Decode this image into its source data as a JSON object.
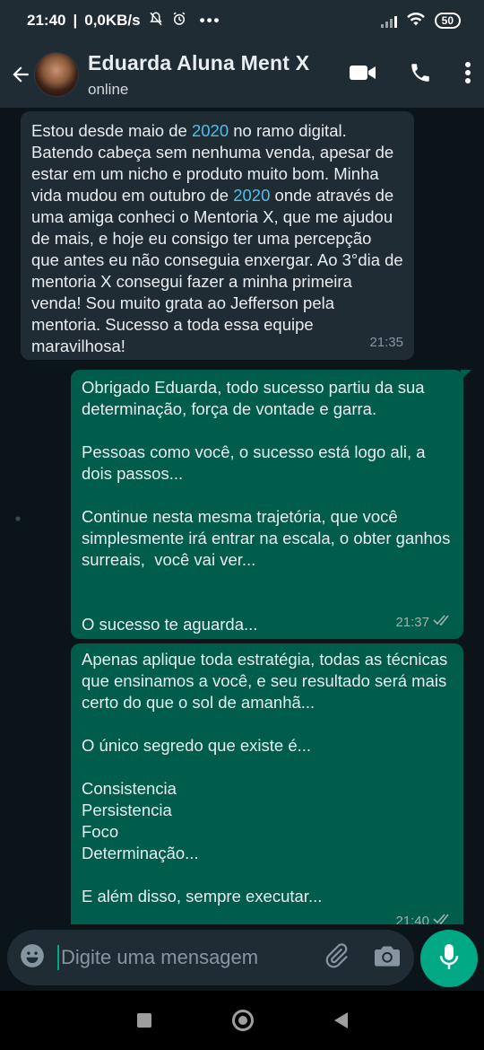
{
  "status_bar": {
    "time": "21:40",
    "net_speed": "0,0KB/s",
    "battery": "50",
    "icons": [
      "mute-icon",
      "alarm-icon",
      "more-dots-icon",
      "signal-icon",
      "wifi-icon",
      "battery-icon"
    ]
  },
  "header": {
    "contact_name": "Eduarda Aluna Ment X",
    "status": "online",
    "icons": [
      "back-arrow-icon",
      "video-call-icon",
      "voice-call-icon",
      "menu-kebab-icon"
    ]
  },
  "messages": [
    {
      "direction": "incoming",
      "text_before_1": "Estou desde maio de ",
      "year_1": "2020",
      "text_between": " no ramo digital. Batendo cabeça sem nenhuma venda, apesar de estar em um nicho e produto muito bom. Minha vida mudou em outubro de ",
      "year_2": "2020",
      "text_after": " onde através de uma amiga conheci o Mentoria X, que me ajudou de mais, e hoje eu consigo ter uma percepção que antes eu não conseguia enxergar. Ao 3°dia de mentoria X consegui fazer a minha primeira venda! Sou muito grata ao Jefferson pela mentoria. Sucesso a toda essa equipe maravilhosa!",
      "time": "21:35"
    },
    {
      "direction": "outgoing",
      "text": "Obrigado Eduarda, todo sucesso partiu da sua determinação, força de vontade e garra.\n\nPessoas como você, o sucesso está logo ali, a dois passos...\n\nContinue nesta mesma trajetória, que você simplesmente irá entrar na escala, o obter ganhos surreais,  você vai ver...\n\n\nO sucesso te aguarda...",
      "time": "21:37",
      "status": "read"
    },
    {
      "direction": "outgoing",
      "text": "Apenas aplique toda estratégia, todas as técnicas que ensinamos a você, e seu resultado será mais certo do que o sol de amanhã...\n\nO único segredo que existe é...\n\nConsistencia\nPersistencia\nFoco\nDeterminação...\n\nE além disso, sempre executar...",
      "time": "21:40",
      "status": "read"
    }
  ],
  "input": {
    "placeholder": "Digite uma mensagem",
    "icons": [
      "emoji-icon",
      "attach-icon",
      "camera-icon",
      "mic-icon"
    ]
  },
  "colors": {
    "background": "#0b1418",
    "header": "#1f2c34",
    "incoming_bubble": "#1f2c34",
    "outgoing_bubble": "#005c4b",
    "accent": "#00a884",
    "link": "#53bdeb"
  }
}
